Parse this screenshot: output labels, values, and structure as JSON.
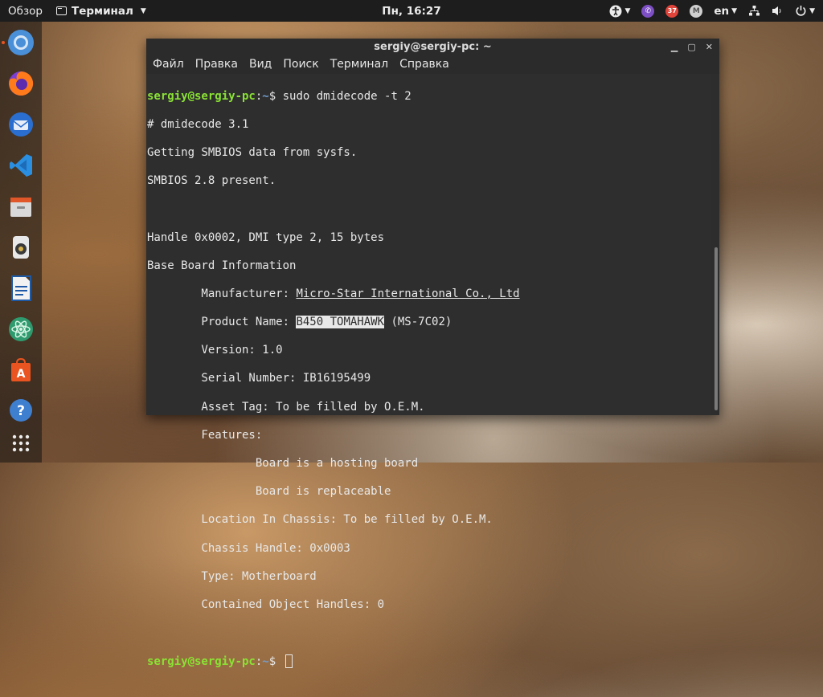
{
  "topbar": {
    "activities": "Обзор",
    "app_menu": "Терминал",
    "clock": "Пн, 16:27",
    "language": "en",
    "badge_count": "37",
    "avatar_letter": "M"
  },
  "dock": {
    "items": [
      "chromium-icon",
      "firefox-icon",
      "thunderbird-icon",
      "vscode-icon",
      "files-icon",
      "rhythmbox-icon",
      "libreoffice-writer-icon",
      "atom-icon",
      "software-center-icon",
      "help-icon",
      "show-apps-icon"
    ]
  },
  "window": {
    "title": "sergiy@sergiy-pc: ~",
    "menu": [
      "Файл",
      "Правка",
      "Вид",
      "Поиск",
      "Терминал",
      "Справка"
    ]
  },
  "terminal": {
    "prompt_user": "sergiy@sergiy-pc",
    "prompt_sep": ":",
    "prompt_path": "~",
    "prompt_sym": "$ ",
    "command": "sudo dmidecode -t 2",
    "l1": "# dmidecode 3.1",
    "l2": "Getting SMBIOS data from sysfs.",
    "l3": "SMBIOS 2.8 present.",
    "l4": "",
    "l5": "Handle 0x0002, DMI type 2, 15 bytes",
    "l6": "Base Board Information",
    "manufacturer_label": "        Manufacturer: ",
    "manufacturer_value": "Micro-Star International Co., Ltd",
    "product_label": "        Product Name: ",
    "product_value_hl": "B450 TOMAHAWK",
    "product_value_rest": " (MS-7C02)",
    "l9": "        Version: 1.0",
    "l10": "        Serial Number: IB16195499",
    "l11": "        Asset Tag: To be filled by O.E.M.",
    "l12": "        Features:",
    "l13": "                Board is a hosting board",
    "l14": "                Board is replaceable",
    "l15": "        Location In Chassis: To be filled by O.E.M.",
    "l16": "        Chassis Handle: 0x0003",
    "l17": "        Type: Motherboard",
    "l18": "        Contained Object Handles: 0"
  }
}
